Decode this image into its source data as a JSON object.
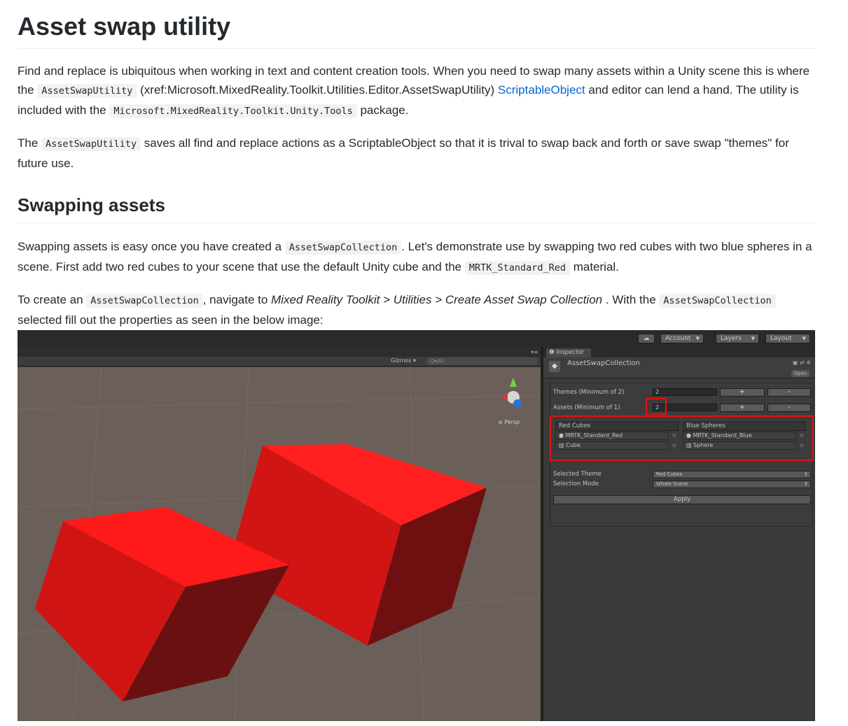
{
  "title": "Asset swap utility",
  "intro": {
    "t1": "Find and replace is ubiquitous when working in text and content creation tools. When you need to swap many assets within a Unity scene this is where the ",
    "code1": "AssetSwapUtility",
    "t2": " (xref:Microsoft.MixedReality.Toolkit.Utilities.Editor.AssetSwapUtility) ",
    "link": "ScriptableObject",
    "t3": " and editor can lend a hand. The utility is included with the ",
    "code2": "Microsoft.MixedReality.Toolkit.Unity.Tools",
    "t4": " package."
  },
  "para2": {
    "t1": "The ",
    "code1": "AssetSwapUtility",
    "t2": " saves all find and replace actions as a ScriptableObject so that it is trival to swap back and forth or save swap \"themes\" for future use."
  },
  "section": "Swapping assets",
  "para3": {
    "t1": "Swapping assets is easy once you have created a ",
    "code1": "AssetSwapCollection",
    "t2": ". Let's demonstrate use by swapping two red cubes with two blue spheres in a scene. First add two red cubes to your scene that use the default Unity cube and the ",
    "code2": "MRTK_Standard_Red",
    "t3": " material."
  },
  "para4": {
    "t1": "To create an ",
    "code1": "AssetSwapCollection",
    "t2": ", navigate to ",
    "em1": "Mixed Reality Toolkit > Utilities > Create Asset Swap Collection",
    "t3": " . With the ",
    "code2": "AssetSwapCollection",
    "t4": " selected fill out the properties as seen in the below image:"
  },
  "unity": {
    "toolbar": {
      "account": "Account",
      "layers": "Layers",
      "layout": "Layout"
    },
    "scene": {
      "gizmos": "Gizmos ▾",
      "search": "Q▾All",
      "persp": "≤ Persp"
    },
    "inspector": {
      "tab": "❶ Inspector",
      "asset_name": "AssetSwapCollection",
      "open": "Open",
      "themes_label": "Themes (Minimum of 2)",
      "themes_value": "2",
      "assets_label": "Assets (Minimum of 1)",
      "assets_value": "2",
      "plus": "+",
      "minus": "-",
      "themes": [
        {
          "name": "Red Cubes",
          "material": "MRTK_Standard_Red",
          "mesh": "Cube"
        },
        {
          "name": "Blue Spheres",
          "material": "MRTK_Standard_Blue",
          "mesh": "Sphere"
        }
      ],
      "selected_theme_label": "Selected Theme",
      "selected_theme_value": "Red Cubes",
      "selection_mode_label": "Selection Mode",
      "selection_mode_value": "Whole Scene",
      "apply": "Apply"
    },
    "colors": {
      "cube_top": "#ff1a1a",
      "cube_front": "#d41414",
      "cube_side": "#7a1010",
      "highlight": "#e31212"
    }
  }
}
